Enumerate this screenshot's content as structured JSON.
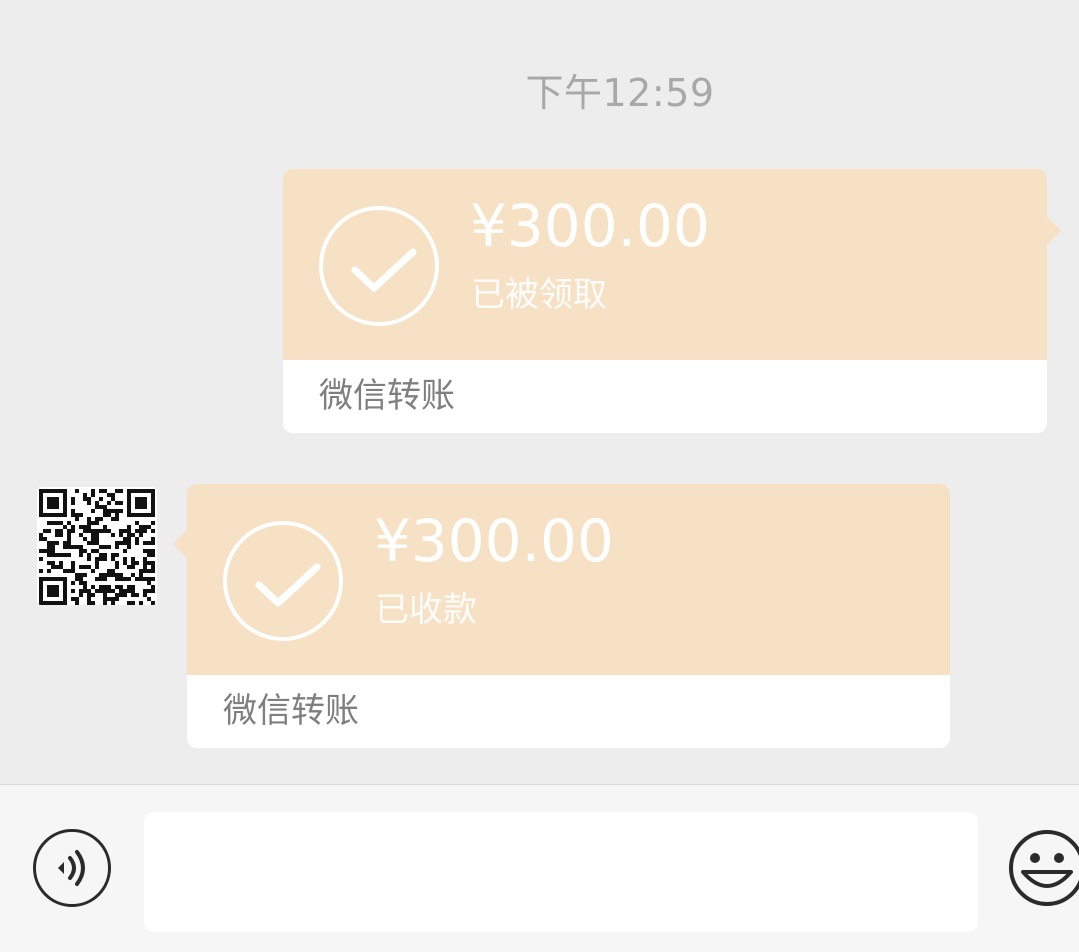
{
  "chat": {
    "timestamp": "下午12:59",
    "messages": [
      {
        "direction": "outgoing",
        "type": "transfer",
        "amount": "¥300.00",
        "status": "已被领取",
        "label": "微信转账",
        "icon": "checkmark-icon"
      },
      {
        "direction": "incoming",
        "type": "transfer",
        "amount": "¥300.00",
        "status": "已收款",
        "label": "微信转账",
        "icon": "checkmark-icon",
        "avatar": "qr-code-avatar"
      }
    ]
  },
  "input_bar": {
    "voice_icon": "voice-icon",
    "input_value": "",
    "emoji_icon": "emoji-icon"
  },
  "colors": {
    "background": "#ededed",
    "card_accent": "#f6e1c5",
    "card_footer": "#ffffff",
    "timestamp_text": "#a8a8a8",
    "label_text": "#7f7f7f"
  }
}
